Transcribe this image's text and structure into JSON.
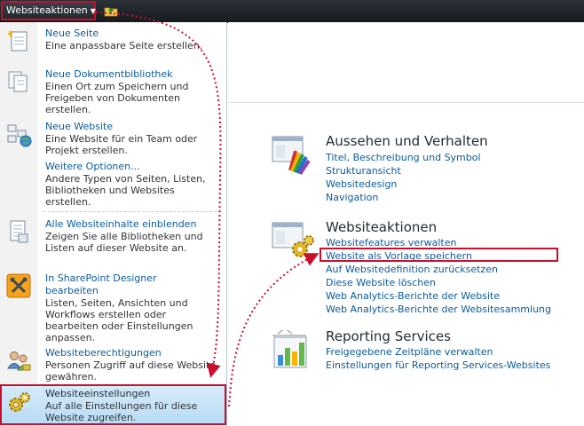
{
  "ribbon": {
    "site_actions_label": "Websiteaktionen",
    "browse_icon": "folder-up-icon"
  },
  "menu": {
    "items": [
      {
        "title": "Neue Seite",
        "desc": "Eine anpassbare Seite erstellen.",
        "icon": "new-page-icon"
      },
      {
        "title": "Neue Dokumentbibliothek",
        "desc": "Einen Ort zum Speichern und Freigeben von Dokumenten erstellen.",
        "icon": "document-library-icon"
      },
      {
        "title": "Neue Website",
        "desc": "Eine Website für ein Team oder Projekt erstellen.",
        "icon": "new-site-icon"
      },
      {
        "title": "Weitere Optionen...",
        "desc": "Andere Typen von Seiten, Listen, Bibliotheken und Websites erstellen.",
        "icon": ""
      },
      {
        "title": "Alle Websiteinhalte einblenden",
        "desc": "Zeigen Sie alle Bibliotheken und Listen auf dieser Website an.",
        "icon": "site-content-icon"
      },
      {
        "title": "In SharePoint Designer bearbeiten",
        "desc": "Listen, Seiten, Ansichten und Workflows erstellen oder bearbeiten oder Einstellungen anpassen.",
        "icon": "designer-tools-icon"
      },
      {
        "title": "Websiteberechtigungen",
        "desc": "Personen Zugriff auf diese Website gewähren.",
        "icon": "permissions-icon"
      },
      {
        "title": "Websiteeinstellungen",
        "desc": "Auf alle Einstellungen für diese Website zugreifen.",
        "icon": "site-settings-gear-icon"
      }
    ]
  },
  "settings": {
    "sections": [
      {
        "heading": "Aussehen und Verhalten",
        "icon": "look-and-feel-icon",
        "links": [
          "Titel, Beschreibung und Symbol",
          "Strukturansicht",
          "Websitedesign",
          "Navigation"
        ]
      },
      {
        "heading": "Websiteaktionen",
        "icon": "site-actions-icon",
        "links": [
          "Websitefeatures verwalten",
          "Website als Vorlage speichern",
          "Auf Websitedefinition zurücksetzen",
          "Diese Website löschen",
          "Web Analytics-Berichte der Website",
          "Web Analytics-Berichte der Websitesammlung"
        ]
      },
      {
        "heading": "Reporting Services",
        "icon": "reporting-services-icon",
        "links": [
          "Freigegebene Zeitpläne verwalten",
          "Einstellungen für Reporting Services-Websites"
        ]
      }
    ]
  },
  "colors": {
    "highlight": "#c8102e",
    "link": "#0a5b99",
    "selected_bg": "#c6e3f7"
  }
}
